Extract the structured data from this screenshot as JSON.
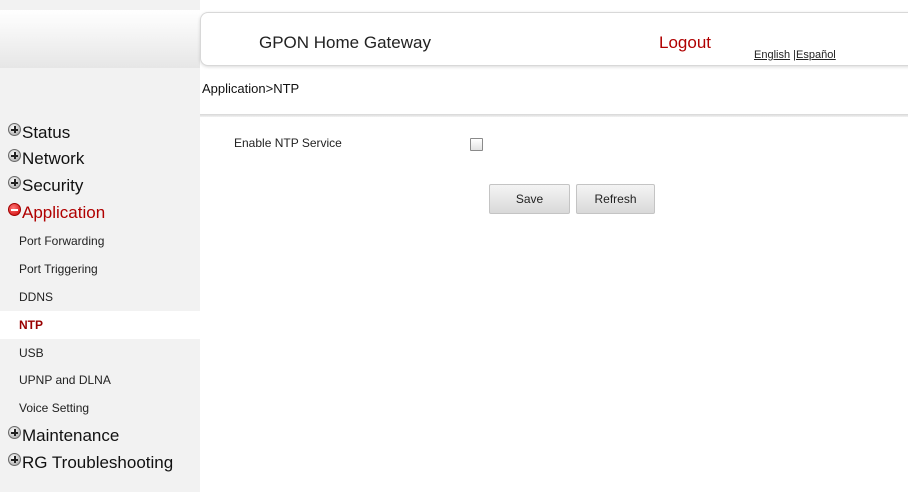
{
  "header": {
    "title": "GPON Home Gateway",
    "logout": "Logout",
    "lang_english": "English",
    "lang_separator": " |",
    "lang_espanol": "Español"
  },
  "breadcrumb": "Application>NTP",
  "sidebar": {
    "groups": [
      {
        "label": "Status",
        "icon": "plus-icon"
      },
      {
        "label": "Network",
        "icon": "plus-icon"
      },
      {
        "label": "Security",
        "icon": "plus-icon"
      },
      {
        "label": "Application",
        "icon": "minus-icon",
        "active": true
      },
      {
        "label": "Maintenance",
        "icon": "plus-icon"
      },
      {
        "label": "RG Troubleshooting",
        "icon": "plus-icon"
      }
    ],
    "application_items": [
      "Port Forwarding",
      "Port Triggering",
      "DDNS",
      "NTP",
      "USB",
      "UPNP and DLNA",
      "Voice Setting"
    ],
    "selected_item": "NTP"
  },
  "form": {
    "enable_ntp_label": "Enable NTP Service",
    "enable_ntp_checked": false
  },
  "buttons": {
    "save": "Save",
    "refresh": "Refresh"
  },
  "colors": {
    "accent_red": "#b00000",
    "sidebar_bg": "#f2f2f2"
  }
}
